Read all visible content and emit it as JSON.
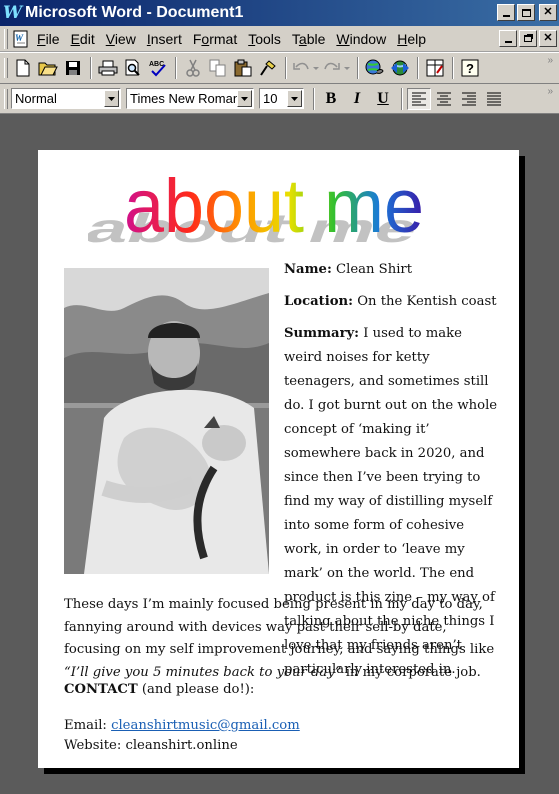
{
  "window": {
    "title": "Microsoft Word - Document1",
    "logo_letter": "W",
    "controls": [
      "minimize",
      "maximize",
      "close"
    ]
  },
  "menubar": {
    "items": [
      {
        "label": "File",
        "accel": "F"
      },
      {
        "label": "Edit",
        "accel": "E"
      },
      {
        "label": "View",
        "accel": "V"
      },
      {
        "label": "Insert",
        "accel": "I"
      },
      {
        "label": "Format",
        "accel": "o"
      },
      {
        "label": "Tools",
        "accel": "T"
      },
      {
        "label": "Table",
        "accel": "a"
      },
      {
        "label": "Window",
        "accel": "W"
      },
      {
        "label": "Help",
        "accel": "H"
      }
    ]
  },
  "toolbar": {
    "buttons": [
      "new-icon",
      "open-icon",
      "save-icon",
      "print-icon",
      "print-preview-icon",
      "spelling-icon",
      "cut-icon",
      "copy-icon",
      "paste-icon",
      "format-painter-icon",
      "undo-icon",
      "redo-icon",
      "hyperlink-icon",
      "web-icon",
      "tables-icon",
      "help-icon"
    ]
  },
  "formatting": {
    "style": "Normal",
    "font": "Times New Roman",
    "size": "10",
    "bold": "B",
    "italic": "I",
    "underline": "U"
  },
  "document": {
    "wordart_title": "about me",
    "name_label": "Name:",
    "name_value": "Clean Shirt",
    "location_label": "Location:",
    "location_value": "On the Kentish coast",
    "summary_label": "Summary:",
    "summary_value": "I used to make weird noises for ketty teenagers, and sometimes still do. I got burnt out on the whole concept of ‘making it’ somewhere back in 2020, and since then I’ve been trying to find my way of distilling myself into some form of cohesive work, in order to ‘leave my mark’ on the world. The end product is this zine – my way of talking about the niche things I love that my friends aren’t particularly interested in.",
    "para_start": "These days I’m mainly focused being present in my day to day, fannying around with devices way past their sell-by date, focusing on my self improvement journey, and saying things like ",
    "para_quote": "“I’ll give you 5 minutes back to your day”",
    "para_end": " in my corporate job.",
    "contact_label": "CONTACT",
    "contact_rest": " (and please do!):",
    "email_label": "Email: ",
    "email_value": "cleanshirtmusic@gmail.com",
    "website_label": "Website: ",
    "website_value": "cleanshirt.online"
  },
  "colors": {
    "titlebar_start": "#0a246a",
    "titlebar_end": "#3a6ea5",
    "chrome": "#d4d0c8",
    "workspace": "#5b5b5b",
    "link": "#1a5fb4"
  }
}
